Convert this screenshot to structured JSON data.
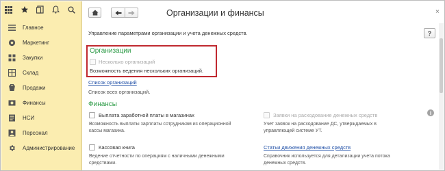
{
  "window": {
    "title": "Организации и финансы",
    "close_glyph": "×",
    "help_glyph": "?"
  },
  "toolbar": {
    "icons": [
      "grid-icon",
      "star-icon",
      "history-icon",
      "bell-icon",
      "search-icon"
    ]
  },
  "sidebar": {
    "items": [
      {
        "label": "Главное",
        "icon": "menu-lines-icon"
      },
      {
        "label": "Маркетинг",
        "icon": "marketing-icon"
      },
      {
        "label": "Закупки",
        "icon": "purchases-icon"
      },
      {
        "label": "Склад",
        "icon": "warehouse-icon"
      },
      {
        "label": "Продажи",
        "icon": "sales-icon"
      },
      {
        "label": "Финансы",
        "icon": "finance-icon"
      },
      {
        "label": "НСИ",
        "icon": "reference-data-icon"
      },
      {
        "label": "Персонал",
        "icon": "person-icon"
      },
      {
        "label": "Администрирование",
        "icon": "gear-icon"
      }
    ]
  },
  "main": {
    "description": "Управление параметрами организации и учета денежных средств.",
    "organizations": {
      "title": "Организации",
      "checkbox_label": "Несколько организаций",
      "checkbox_checked": false,
      "checkbox_enabled": false,
      "hint": "Возможность ведения нескольких организаций.",
      "link": "Список организаций",
      "link_hint": "Список всех организаций."
    },
    "finance": {
      "title": "Финансы",
      "payroll_label": "Выплата заработной платы в магазинах",
      "payroll_checked": false,
      "payroll_hint_1": "Возможность выплаты зарплаты сотрудникам из операционной",
      "payroll_hint_2": "кассы магазина.",
      "requests_label": "Заявки на расходование денежных средств",
      "requests_checked": false,
      "requests_hint_1": "Учет заявок на расходование ДС, утверждаемых в",
      "requests_hint_2": "управляющей системе УТ.",
      "cashbook_label": "Кассовая книга",
      "cashbook_checked": false,
      "cashbook_hint_1": "Ведение отчетности по операциям с наличными денежными",
      "cashbook_hint_2": "средствами.",
      "cashflow_link": "Статьи движения денежных средств",
      "cashflow_hint_1": "Справочник используется для детализации учета потока",
      "cashflow_hint_2": "денежных средств."
    }
  },
  "colors": {
    "sidebar_bg": "#fbedb0",
    "section_title": "#2d9b47",
    "highlight_border": "#c0282f",
    "link": "#2352a8"
  }
}
